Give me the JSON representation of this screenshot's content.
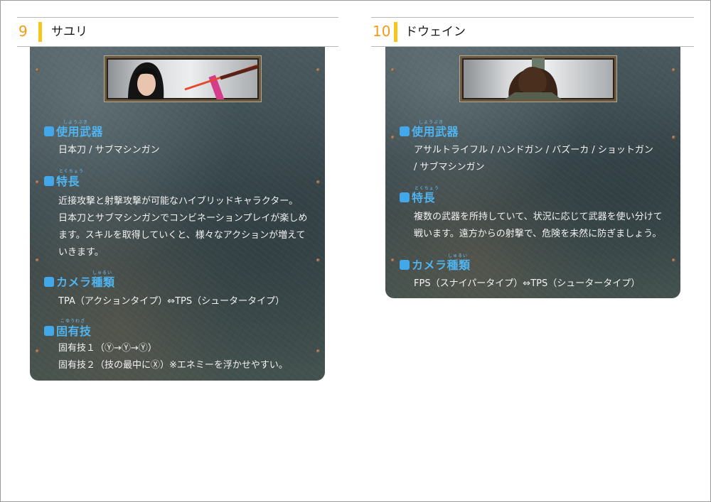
{
  "cards": [
    {
      "number": "9",
      "name": "サユリ",
      "sections": [
        {
          "title": "使用武器",
          "ruby": "しようぶき",
          "text": "日本刀 / サブマシンガン"
        },
        {
          "title": "特長",
          "ruby": "とくちょう",
          "text": "近接攻撃と射撃攻撃が可能なハイブリッドキャラクター。\n日本刀とサブマシンガンでコンビネーションプレイが楽しめ\nます。スキルを取得していくと、様々なアクションが増えて\nいきます。"
        },
        {
          "title": "カメラ種類",
          "ruby": "しゅるい",
          "text": "TPA（アクションタイプ）⇔TPS（シュータータイプ）"
        },
        {
          "title": "固有技",
          "ruby": "こゆうわざ",
          "text": "固有技１（Ⓨ→Ⓨ→Ⓨ）\n固有技２（技の最中にⓍ）※エネミーを浮かせやすい。"
        }
      ]
    },
    {
      "number": "10",
      "name": "ドウェイン",
      "sections": [
        {
          "title": "使用武器",
          "ruby": "しようぶき",
          "text": "アサルトライフル / ハンドガン / バズーカ / ショットガン\n/ サブマシンガン"
        },
        {
          "title": "特長",
          "ruby": "とくちょう",
          "text": "複数の武器を所持していて、状況に応じて武器を使い分けて\n戦います。遠方からの射撃で、危険を未然に防ぎましょう。"
        },
        {
          "title": "カメラ種類",
          "ruby": "しゅるい",
          "text": "FPS（スナイパータイプ）⇔TPS（シュータータイプ）"
        }
      ]
    }
  ],
  "colors": {
    "number": "#f39a1a",
    "accent_bar": "#f7c51c",
    "section_title": "#4fb4ef",
    "body_text": "#f2f2f2"
  }
}
